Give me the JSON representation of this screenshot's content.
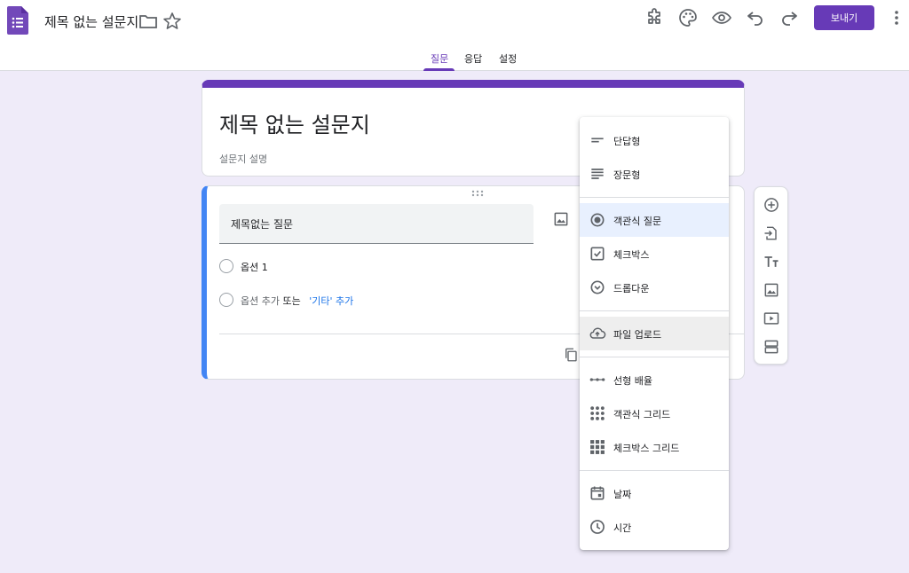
{
  "colors": {
    "accent": "#673ab7",
    "question_border": "#4285f4",
    "link": "#1a73e8",
    "background": "#efebf9"
  },
  "header": {
    "doc_title": "제목 없는 설문지",
    "send_label": "보내기",
    "icons": [
      "forms-logo-icon",
      "folder-icon",
      "star-icon",
      "addon-puzzle-icon",
      "palette-icon",
      "preview-eye-icon",
      "undo-icon",
      "redo-icon",
      "more-vert-icon"
    ]
  },
  "tabs": [
    {
      "label": "질문",
      "active": true
    },
    {
      "label": "응답",
      "active": false
    },
    {
      "label": "설정",
      "active": false
    }
  ],
  "form": {
    "title": "제목 없는 설문지",
    "description_placeholder": "설문지 설명"
  },
  "question": {
    "title": "제목없는 질문",
    "option_1": "옵션 1",
    "add_option": "옵션 추가",
    "or": "또는",
    "add_other": "'기타' 추가"
  },
  "side_toolbar": {
    "icons": [
      "add-question-icon",
      "import-questions-icon",
      "add-title-icon",
      "add-image-icon",
      "add-video-icon",
      "add-section-icon"
    ]
  },
  "question_types": [
    {
      "label": "단답형",
      "icon": "short-answer-icon"
    },
    {
      "label": "장문형",
      "icon": "paragraph-icon"
    },
    {
      "label": "객관식 질문",
      "icon": "multiple-choice-icon",
      "selected": true
    },
    {
      "label": "체크박스",
      "icon": "checkbox-icon"
    },
    {
      "label": "드롭다운",
      "icon": "dropdown-icon"
    },
    {
      "label": "파일 업로드",
      "icon": "file-upload-icon",
      "hover": true
    },
    {
      "label": "선형 배율",
      "icon": "linear-scale-icon"
    },
    {
      "label": "객관식 그리드",
      "icon": "mc-grid-icon"
    },
    {
      "label": "체크박스 그리드",
      "icon": "checkbox-grid-icon"
    },
    {
      "label": "날짜",
      "icon": "date-icon"
    },
    {
      "label": "시간",
      "icon": "time-icon"
    }
  ]
}
